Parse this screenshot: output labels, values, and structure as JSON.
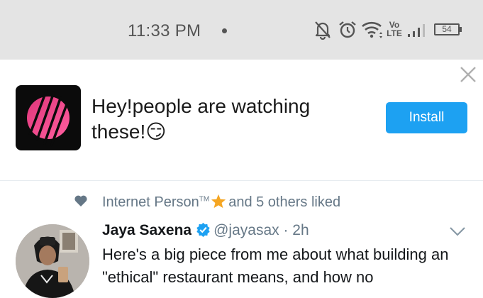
{
  "status_bar": {
    "time": "11:33 PM",
    "volte_top": "Vo",
    "volte_bottom": "LTE",
    "battery": "54",
    "icons": [
      "bell-off-icon",
      "alarm-icon",
      "wifi-icon",
      "signal-icon",
      "battery-icon"
    ]
  },
  "ad": {
    "text": "Hey!people are watching these!😏",
    "install_label": "Install",
    "accent_color": "#1da1f2",
    "icons": [
      "close-icon",
      "app-icon"
    ]
  },
  "social_context": {
    "liker": "Internet Person",
    "trademark": "TM",
    "rest": "and 5 others liked",
    "icons": [
      "heart-icon",
      "star-icon"
    ]
  },
  "tweet": {
    "author_name": "Jaya Saxena",
    "handle_time": "@jayasax · 2h",
    "text": "Here's a big piece from me about what building an \"ethical\" restaurant means, and how no",
    "icons": [
      "verified-icon",
      "chevron-down-icon",
      "avatar"
    ]
  }
}
